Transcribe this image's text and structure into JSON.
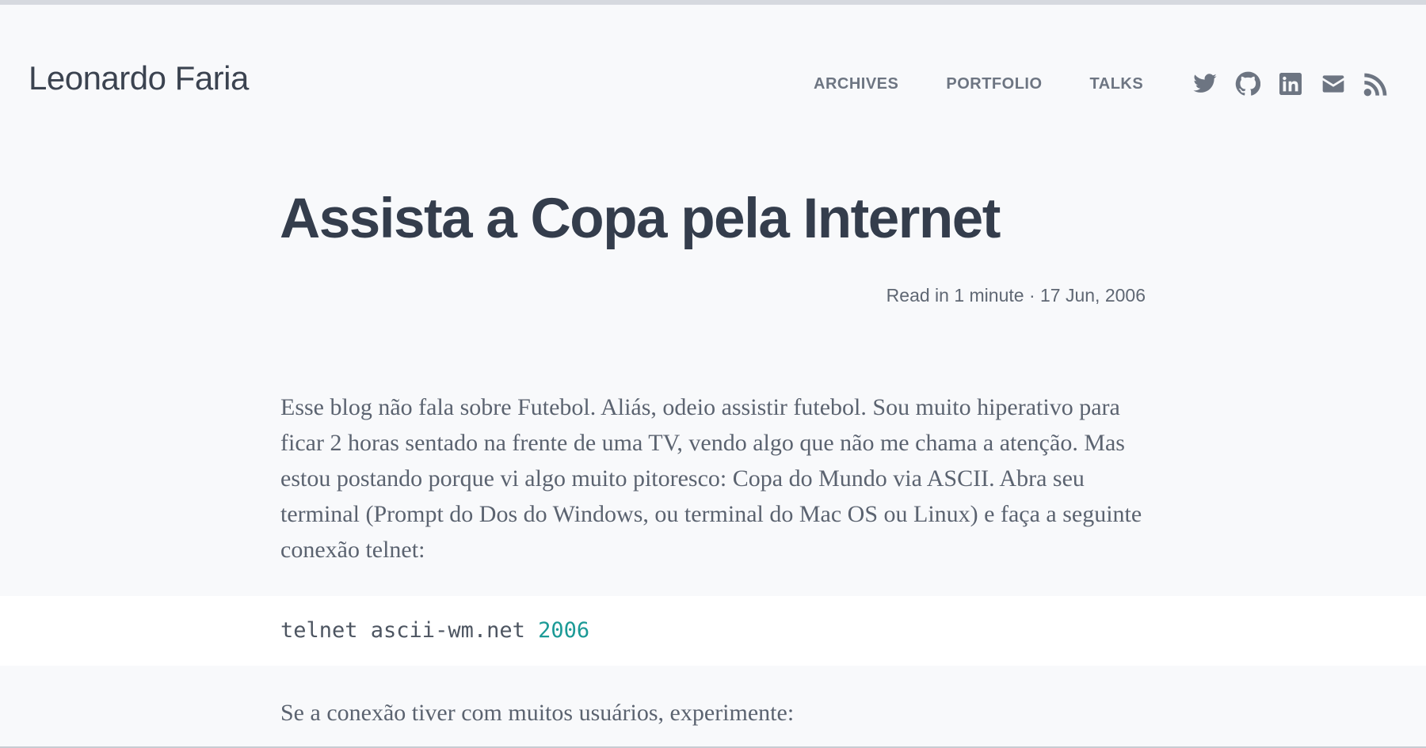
{
  "header": {
    "site_title": "Leonardo Faria",
    "nav": [
      {
        "label": "ARCHIVES"
      },
      {
        "label": "PORTFOLIO"
      },
      {
        "label": "TALKS"
      }
    ],
    "social_icons": [
      "twitter-icon",
      "github-icon",
      "linkedin-icon",
      "email-icon",
      "rss-icon"
    ]
  },
  "post": {
    "title": "Assista a Copa pela Internet",
    "meta": "Read in 1 minute · 17 Jun, 2006",
    "paragraph_1": "Esse blog não fala sobre Futebol. Aliás, odeio assistir futebol. Sou muito hiperativo para ficar 2 horas sentado na frente de uma TV, vendo algo que não me chama a atenção. Mas estou postando porque vi algo muito pitoresco: Copa do Mundo via ASCII. Abra seu terminal (Prompt do Dos do Windows, ou terminal do Mac OS ou Linux) e faça a seguinte conexão telnet:",
    "code": {
      "command": "telnet ascii-wm.net ",
      "port": "2006"
    },
    "paragraph_2": "Se a conexão tiver com muitos usuários, experimente:"
  },
  "colors": {
    "background": "#f8f9fb",
    "title": "#343d4c",
    "nav_text": "#6d7582",
    "code_number": "#1b9a96"
  }
}
